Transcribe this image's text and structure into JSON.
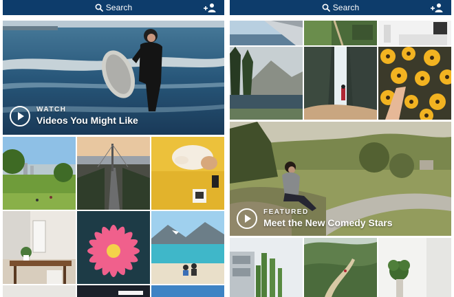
{
  "theme": {
    "topbar_color": "#0d3c6b",
    "text_color": "#ffffff"
  },
  "left_screen": {
    "search": {
      "label": "Search",
      "icon": "search-icon"
    },
    "add_user_icon": "add-user-icon",
    "hero": {
      "kicker": "WATCH",
      "title": "Videos You Might Like",
      "icon": "play-icon"
    }
  },
  "right_screen": {
    "search": {
      "label": "Search",
      "icon": "search-icon"
    },
    "add_user_icon": "add-user-icon",
    "hero": {
      "kicker": "FEATURED",
      "title": "Meet the New Comedy Stars",
      "icon": "play-icon"
    }
  }
}
